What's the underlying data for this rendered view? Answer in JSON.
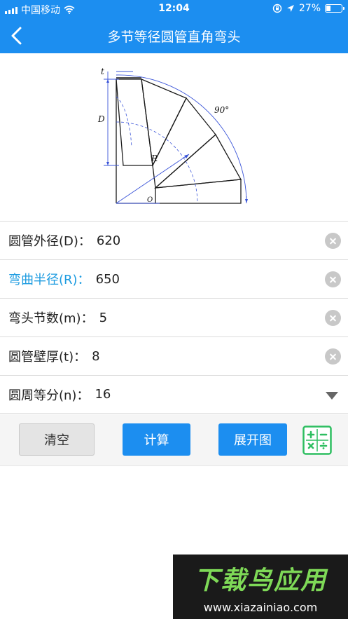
{
  "status": {
    "carrier": "中国移动",
    "time": "12:04",
    "battery_percent": "27%",
    "battery_level": 0.27
  },
  "header": {
    "title": "多节等径圆管直角弯头"
  },
  "figure": {
    "label_t": "t",
    "label_D": "D",
    "label_R": "R",
    "label_angle": "90°",
    "label_O": "O"
  },
  "fields": [
    {
      "label": "圆管外径(D)：",
      "value": "620"
    },
    {
      "label": "弯曲半径(R)：",
      "value": "650"
    },
    {
      "label": "弯头节数(m)：",
      "value": "5"
    },
    {
      "label": "圆管壁厚(t)：",
      "value": "8"
    },
    {
      "label": "圆周等分(n)：",
      "value": "16"
    }
  ],
  "buttons": {
    "clear": "清空",
    "calculate": "计算",
    "expand": "展开图"
  },
  "watermark": {
    "title": "下载鸟应用",
    "url": "www.xiazainiao.com"
  },
  "colors": {
    "accent": "#1C8EF0",
    "active_label": "#1C9BE0",
    "calculator_icon": "#2DBE60"
  }
}
